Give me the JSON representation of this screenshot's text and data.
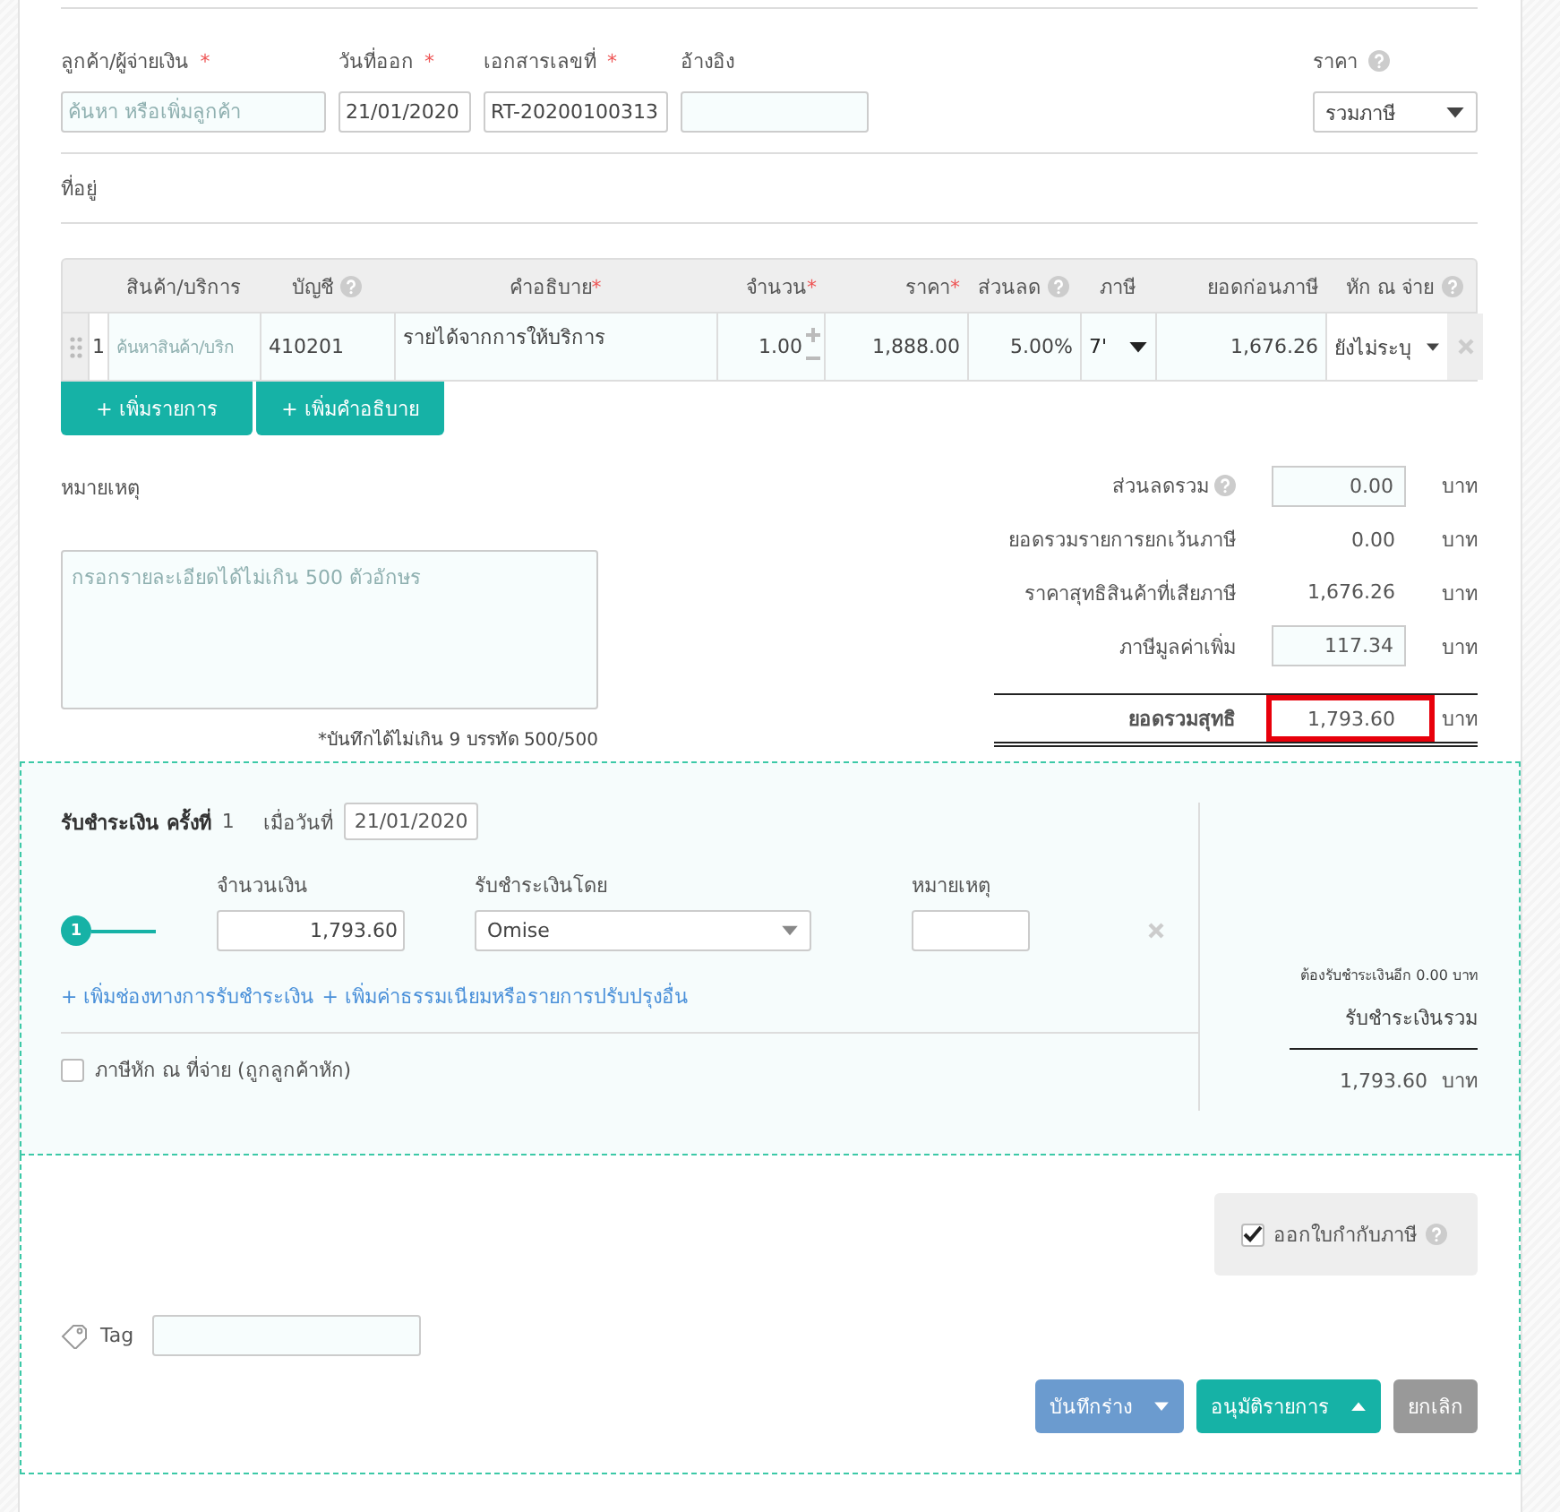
{
  "header": {
    "fields": [
      {
        "label": "ลูกค้า/ผู้จ่ายเงิน",
        "mark": "*",
        "placeholder": "ค้นหา หรือเพิ่มลูกค้า"
      },
      {
        "label": "วันที่ออก",
        "mark": "*",
        "value": "21/01/2020"
      },
      {
        "label": "เอกสารเลขที่",
        "mark": "*",
        "value": "RT-20200100313"
      },
      {
        "label": "อ้างอิง"
      }
    ],
    "price_type": {
      "label": "ราคา",
      "value": "รวมภาษี"
    },
    "address": {
      "label": "ที่อยู่"
    }
  },
  "table": {
    "columns": [
      {
        "label": "สินค้า/บริการ"
      },
      {
        "label": "บัญชี",
        "help": true
      },
      {
        "label": "คำอธิบาย",
        "mark": "*"
      },
      {
        "label": "จำนวน",
        "mark": "*"
      },
      {
        "label": "ราคา",
        "mark": "*"
      },
      {
        "label": "ส่วนลด",
        "help": true
      },
      {
        "label": "ภาษี"
      },
      {
        "label": "ยอดก่อนภาษี"
      },
      {
        "label": "หัก ณ จ่าย",
        "help": true
      }
    ],
    "rows": [
      {
        "number": "1",
        "product_placeholder": "ค้นหาสินค้า/บริก",
        "account": "410201",
        "description": "รายได้จากการให้บริการ",
        "quantity": "1.00",
        "price": "1,888.00",
        "discount": "5.00%",
        "vat": "7'",
        "subtotal": "1,676.26",
        "withholding": "ยังไม่ระบุ"
      }
    ],
    "add_buttons": [
      "+ เพิ่มรายการ",
      "+ เพิ่มคำอธิบาย"
    ]
  },
  "notes": {
    "label": "หมายเหตุ",
    "placeholder": "กรอกรายละเอียดได้ไม่เกิน 500 ตัวอักษร",
    "counter": "*บันทึกได้ไม่เกิน 9 บรรทัด 500/500"
  },
  "summary": [
    {
      "kind": "input",
      "label": "ส่วนลดรวม",
      "help": true,
      "value": "0.00",
      "unit": "บาท"
    },
    {
      "kind": "text",
      "label": "ยอดรวมรายการยกเว้นภาษี",
      "value": "0.00",
      "unit": "บาท"
    },
    {
      "kind": "text",
      "label": "ราคาสุทธิสินค้าที่เสียภาษี",
      "value": "1,676.26",
      "unit": "บาท"
    },
    {
      "kind": "input",
      "label": "ภาษีมูลค่าเพิ่ม",
      "value": "117.34",
      "unit": "บาท"
    },
    {
      "kind": "total",
      "label": "ยอดรวมสุทธิ",
      "value": "1,793.60",
      "unit": "บาท",
      "highlighted": true
    }
  ],
  "payment": {
    "title": "รับชำระเงิน ครั้งที่",
    "number": "1",
    "date_label": "เมื่อวันที่",
    "date": "21/01/2020",
    "step": "1",
    "amount_label": "จำนวนเงิน",
    "amount": "1,793.60",
    "method_label": "รับชำระเงินโดย",
    "method": "Omise",
    "note_label": "หมายเหตุ",
    "links": [
      "+ เพิ่มช่องทางการรับชำระเงิน",
      "+ เพิ่มค่าธรรมเนียมหรือรายการปรับปรุงอื่น"
    ],
    "withholding": {
      "label": "ภาษีหัก ณ ที่จ่าย (ถูกลูกค้าหัก)",
      "checked": false
    },
    "remaining": "ต้องรับชำระเงินอีก 0.00 บาท",
    "total_label": "รับชำระเงินรวม",
    "total": "1,793.60",
    "unit": "บาท"
  },
  "tax_invoice": {
    "label": "ออกใบกำกับภาษี",
    "checked": true
  },
  "tag": {
    "label": "Tag"
  },
  "actions": [
    {
      "kind": "draft",
      "label": "บันทึกร่าง"
    },
    {
      "kind": "approve",
      "label": "อนุมัติรายการ"
    },
    {
      "kind": "cancel",
      "label": "ยกเลิก"
    }
  ]
}
